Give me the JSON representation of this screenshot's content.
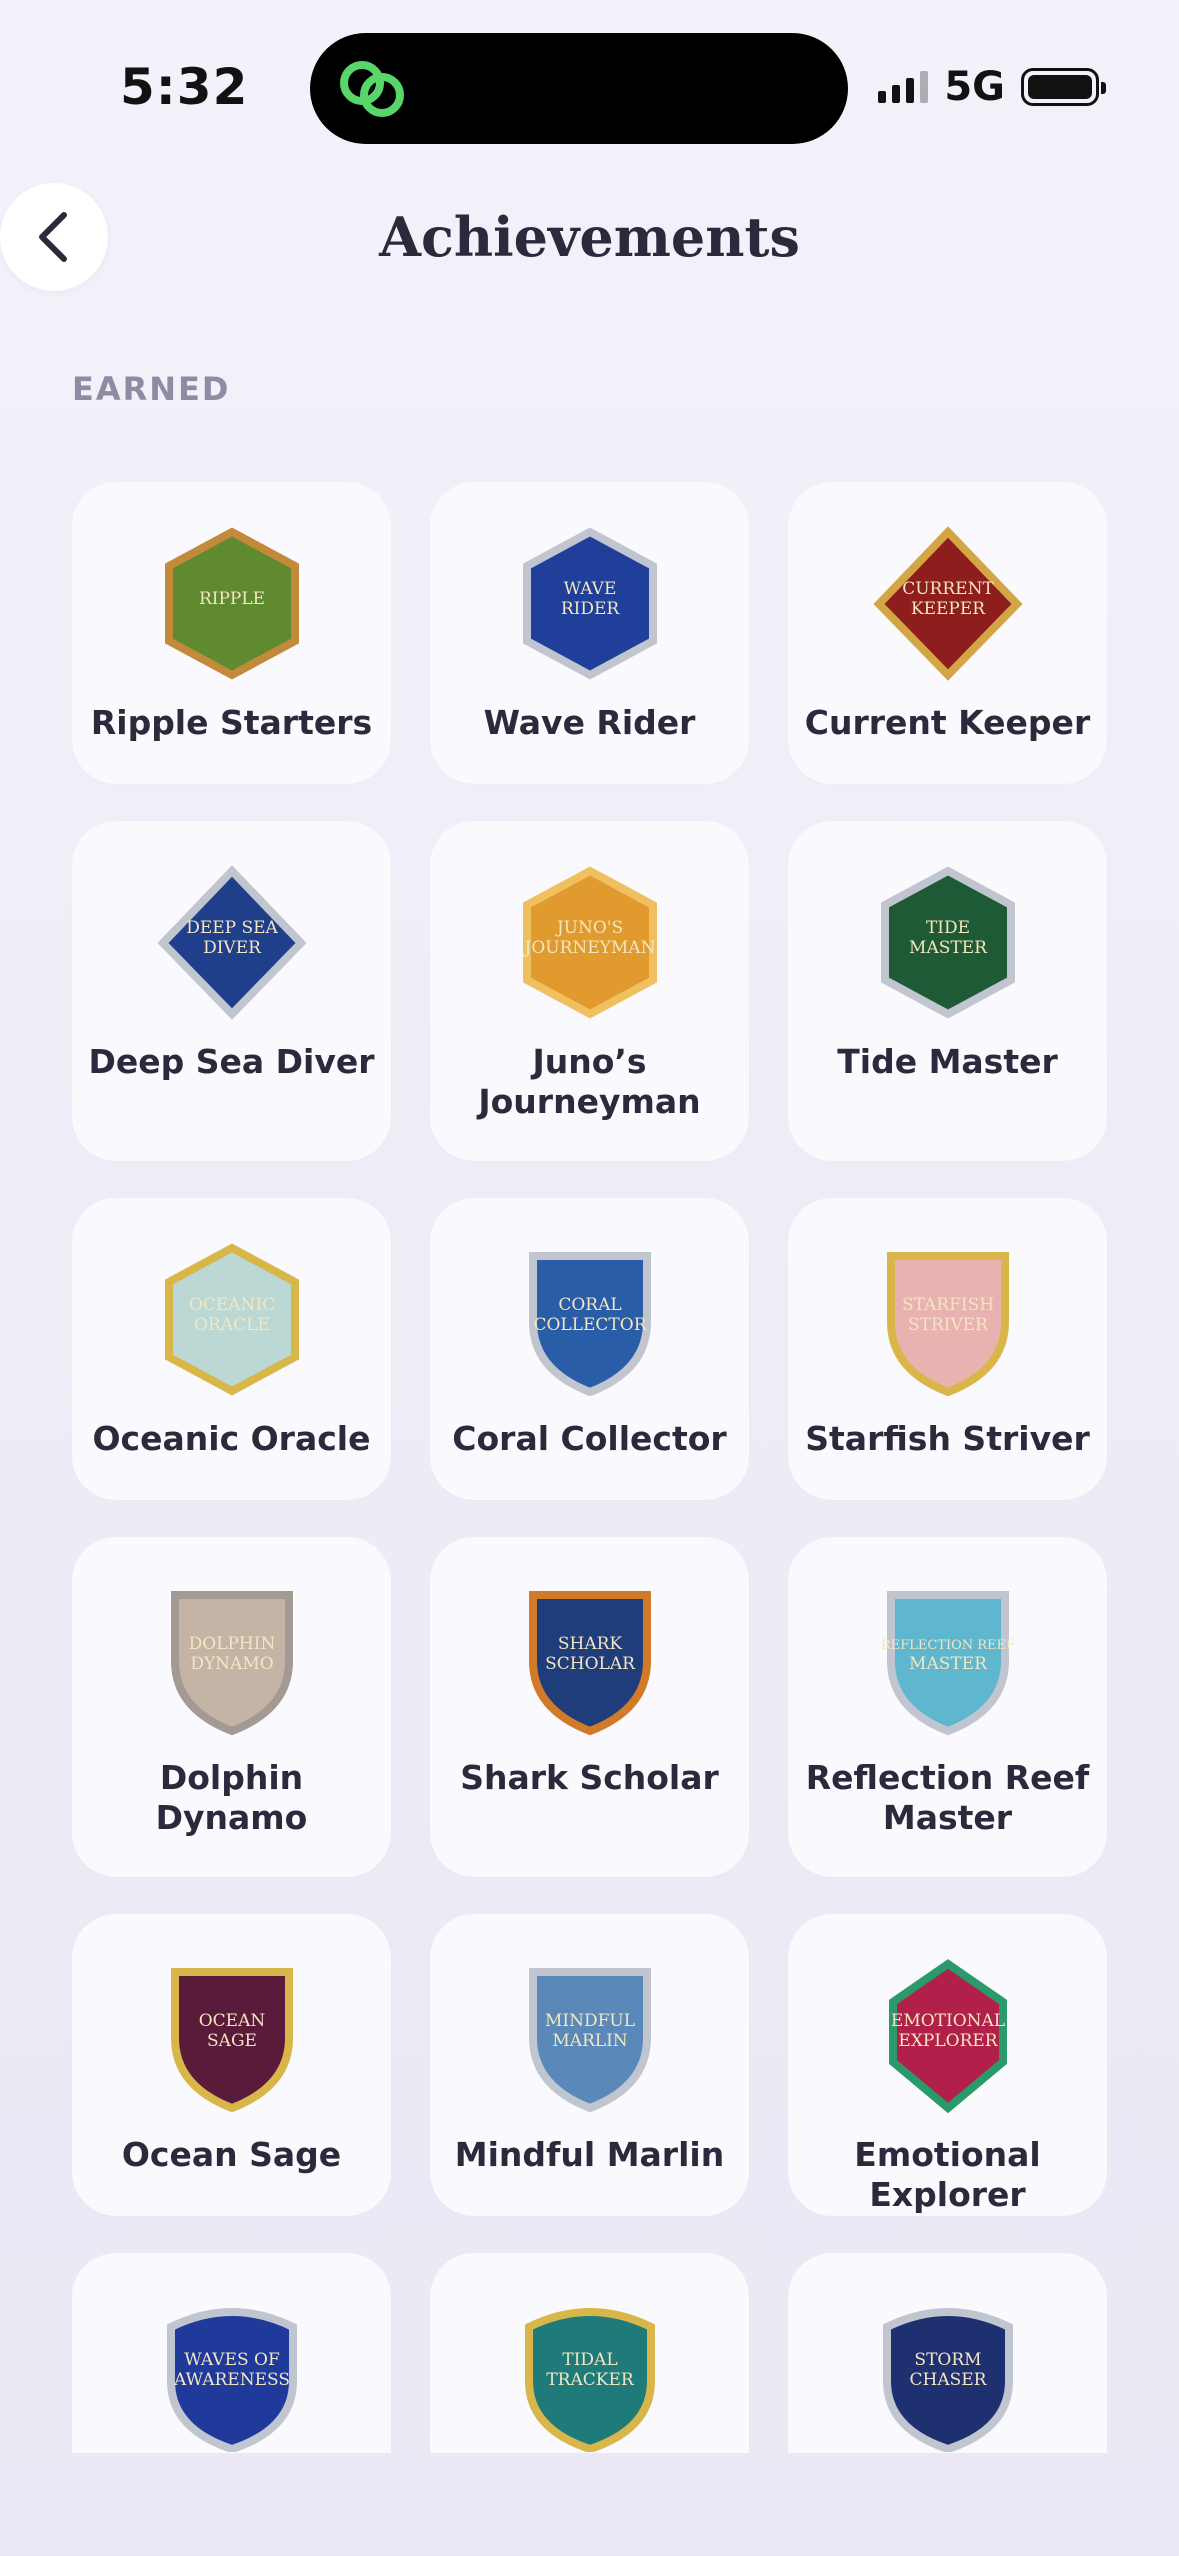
{
  "status_bar": {
    "time": "5:32",
    "network": "5G"
  },
  "header": {
    "title": "Achievements"
  },
  "section": {
    "label": "EARNED"
  },
  "badges": [
    {
      "name": "Ripple Starters",
      "badge_text": "RIPPLE",
      "shape": "hexagon",
      "color": "#5f8a2f",
      "trim": "#c28a3a"
    },
    {
      "name": "Wave Rider",
      "badge_text": "WAVE RIDER",
      "shape": "hexagon",
      "color": "#1f3f9a",
      "trim": "#c0c5d0"
    },
    {
      "name": "Current Keeper",
      "badge_text": "CURRENT KEEPER",
      "shape": "diamond",
      "color": "#8e1d1d",
      "trim": "#d4a545"
    },
    {
      "name": "Deep Sea Diver",
      "badge_text": "DEEP SEA DIVER",
      "shape": "diamond",
      "color": "#1f3f8a",
      "trim": "#c0c5d0"
    },
    {
      "name": "Juno’s Journeyman",
      "badge_text": "JUNO'S JOURNEYMAN",
      "shape": "hexagon",
      "color": "#e09a2e",
      "trim": "#f0c060"
    },
    {
      "name": "Tide Master",
      "badge_text": "TIDE MASTER",
      "shape": "hexagon",
      "color": "#1f5a36",
      "trim": "#c0c5d0"
    },
    {
      "name": "Oceanic Oracle",
      "badge_text": "OCEANIC ORACLE",
      "shape": "hexagon",
      "color": "#bcd8d5",
      "trim": "#d9b64a"
    },
    {
      "name": "Coral Collector",
      "badge_text": "CORAL COLLECTOR",
      "shape": "shield",
      "color": "#2a5da8",
      "trim": "#c0c5d0"
    },
    {
      "name": "Starfish Striver",
      "badge_text": "STARFISH STRIVER",
      "shape": "shield",
      "color": "#e8b2b0",
      "trim": "#d9b64a"
    },
    {
      "name": "Dolphin Dynamo",
      "badge_text": "DOLPHIN DYNAMO",
      "shape": "shield",
      "color": "#c4b4a6",
      "trim": "#a39a94"
    },
    {
      "name": "Shark Scholar",
      "badge_text": "SHARK SCHOLAR",
      "shape": "shield",
      "color": "#1f3d7a",
      "trim": "#d07a2a"
    },
    {
      "name": "Reflection Reef Master",
      "badge_text": "REFLECTION REEF MASTER",
      "shape": "shield",
      "color": "#5fb7cf",
      "trim": "#c0c5d0"
    },
    {
      "name": "Ocean Sage",
      "badge_text": "OCEAN SAGE",
      "shape": "shield",
      "color": "#5a1a3a",
      "trim": "#d9b64a"
    },
    {
      "name": "Mindful Marlin",
      "badge_text": "MINDFUL MARLIN",
      "shape": "shield",
      "color": "#5a88b8",
      "trim": "#c0c5d0"
    },
    {
      "name": "Emotional Explorer",
      "badge_text": "EMOTIONAL EXPLORER",
      "shape": "gem",
      "color": "#b0204a",
      "trim": "#2a9a6a"
    },
    {
      "name": "",
      "badge_text": "WAVES OF AWARENESS",
      "shape": "round-shield",
      "color": "#1f3a9a",
      "trim": "#c0c5d0"
    },
    {
      "name": "",
      "badge_text": "TIDAL TRACKER",
      "shape": "round-shield",
      "color": "#1f7a7a",
      "trim": "#d9b64a"
    },
    {
      "name": "",
      "badge_text": "STORM CHASER",
      "shape": "round-shield",
      "color": "#1f3070",
      "trim": "#c0c5d0"
    }
  ]
}
